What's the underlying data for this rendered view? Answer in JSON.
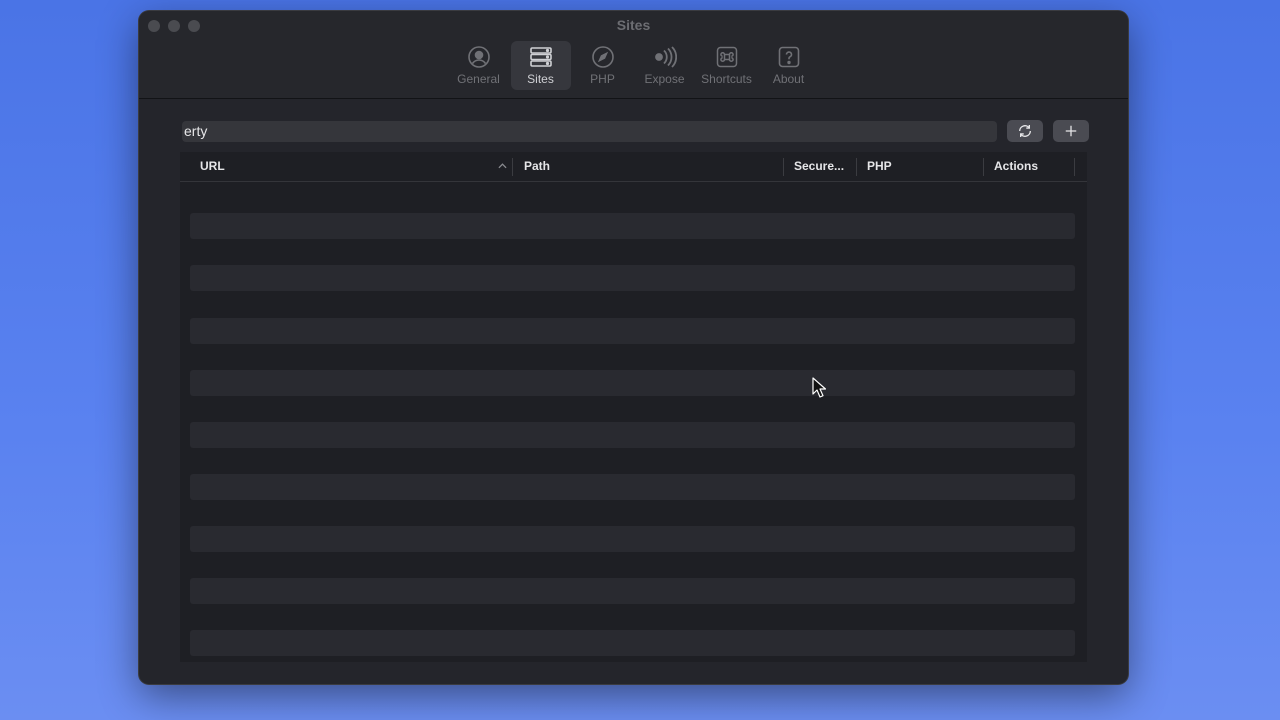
{
  "window": {
    "title": "Sites"
  },
  "toolbar": {
    "items": [
      {
        "label": "General",
        "icon": "user-circle-icon",
        "active": false
      },
      {
        "label": "Sites",
        "icon": "server-stack-icon",
        "active": true
      },
      {
        "label": "PHP",
        "icon": "compass-icon",
        "active": false
      },
      {
        "label": "Expose",
        "icon": "broadcast-icon",
        "active": false
      },
      {
        "label": "Shortcuts",
        "icon": "command-key-icon",
        "active": false
      },
      {
        "label": "About",
        "icon": "question-icon",
        "active": false
      }
    ]
  },
  "search": {
    "value": "erty"
  },
  "actions": {
    "refresh_icon": "refresh-icon",
    "add_icon": "plus-icon"
  },
  "table": {
    "columns": [
      "URL",
      "Path",
      "Secure...",
      "PHP",
      "Actions"
    ],
    "sort": {
      "column": "URL",
      "direction": "ascending"
    },
    "rows": []
  },
  "colors": {
    "background": "#5a82f0",
    "window": "#24252b",
    "active_tab": "#36373d"
  }
}
